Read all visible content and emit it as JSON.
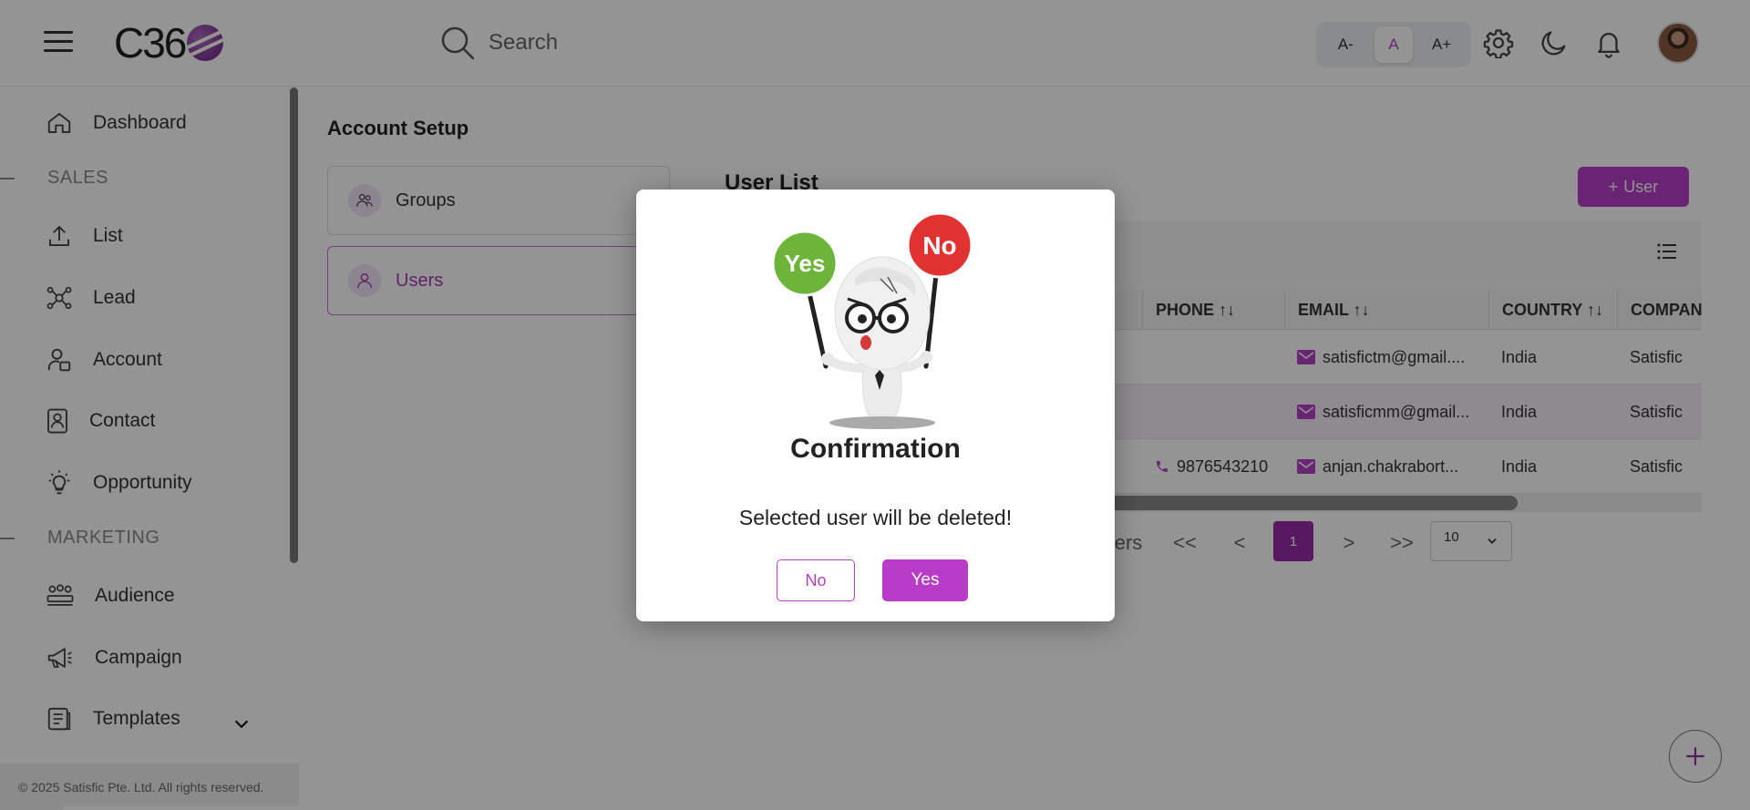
{
  "header": {
    "logo_text": "C36",
    "search_placeholder": "Search",
    "font_controls": [
      "A-",
      "A",
      "A+"
    ]
  },
  "sidebar": {
    "items": [
      {
        "label": "Dashboard",
        "icon": "home-icon"
      },
      {
        "label": "List",
        "icon": "upload-icon"
      },
      {
        "label": "Lead",
        "icon": "network-icon"
      },
      {
        "label": "Account",
        "icon": "account-icon"
      },
      {
        "label": "Contact",
        "icon": "contact-icon"
      },
      {
        "label": "Opportunity",
        "icon": "lightbulb-icon"
      },
      {
        "label": "Audience",
        "icon": "audience-icon"
      },
      {
        "label": "Campaign",
        "icon": "megaphone-icon"
      },
      {
        "label": "Templates",
        "icon": "templates-icon"
      }
    ],
    "sections": [
      "SALES",
      "MARKETING"
    ],
    "footer": "© 2025 Satisfic Pte. Ltd. All rights reserved."
  },
  "main": {
    "page_title": "Account Setup",
    "tabs": [
      {
        "label": "Groups"
      },
      {
        "label": "Users"
      }
    ],
    "list_title": "User List",
    "add_user_label": "User",
    "table": {
      "columns": [
        "↑↓",
        "PHONE ↑↓",
        "EMAIL ↑↓",
        "COUNTRY ↑↓",
        "COMPAN"
      ],
      "rows": [
        {
          "phone": "",
          "email": "satisfictm@gmail....",
          "country": "India",
          "company": "Satisfic"
        },
        {
          "phone": "",
          "email": "satisficmm@gmail...",
          "country": "India",
          "company": "Satisfic"
        },
        {
          "phone": "9876543210",
          "email": "anjan.chakrabort...",
          "country": "India",
          "company": "Satisfic"
        }
      ]
    },
    "pagination": {
      "partial_label": "ers",
      "first": "<<",
      "prev": "<",
      "current": "1",
      "next": ">",
      "last": ">>",
      "page_size": "10"
    }
  },
  "modal": {
    "sign_yes": "Yes",
    "sign_no": "No",
    "title": "Confirmation",
    "message": "Selected user will be deleted!",
    "no_label": "No",
    "yes_label": "Yes"
  },
  "colors": {
    "accent": "#b93cc9",
    "accent_dark": "#9a2ca8",
    "overlay": "rgba(0,0,0,0.42)"
  }
}
